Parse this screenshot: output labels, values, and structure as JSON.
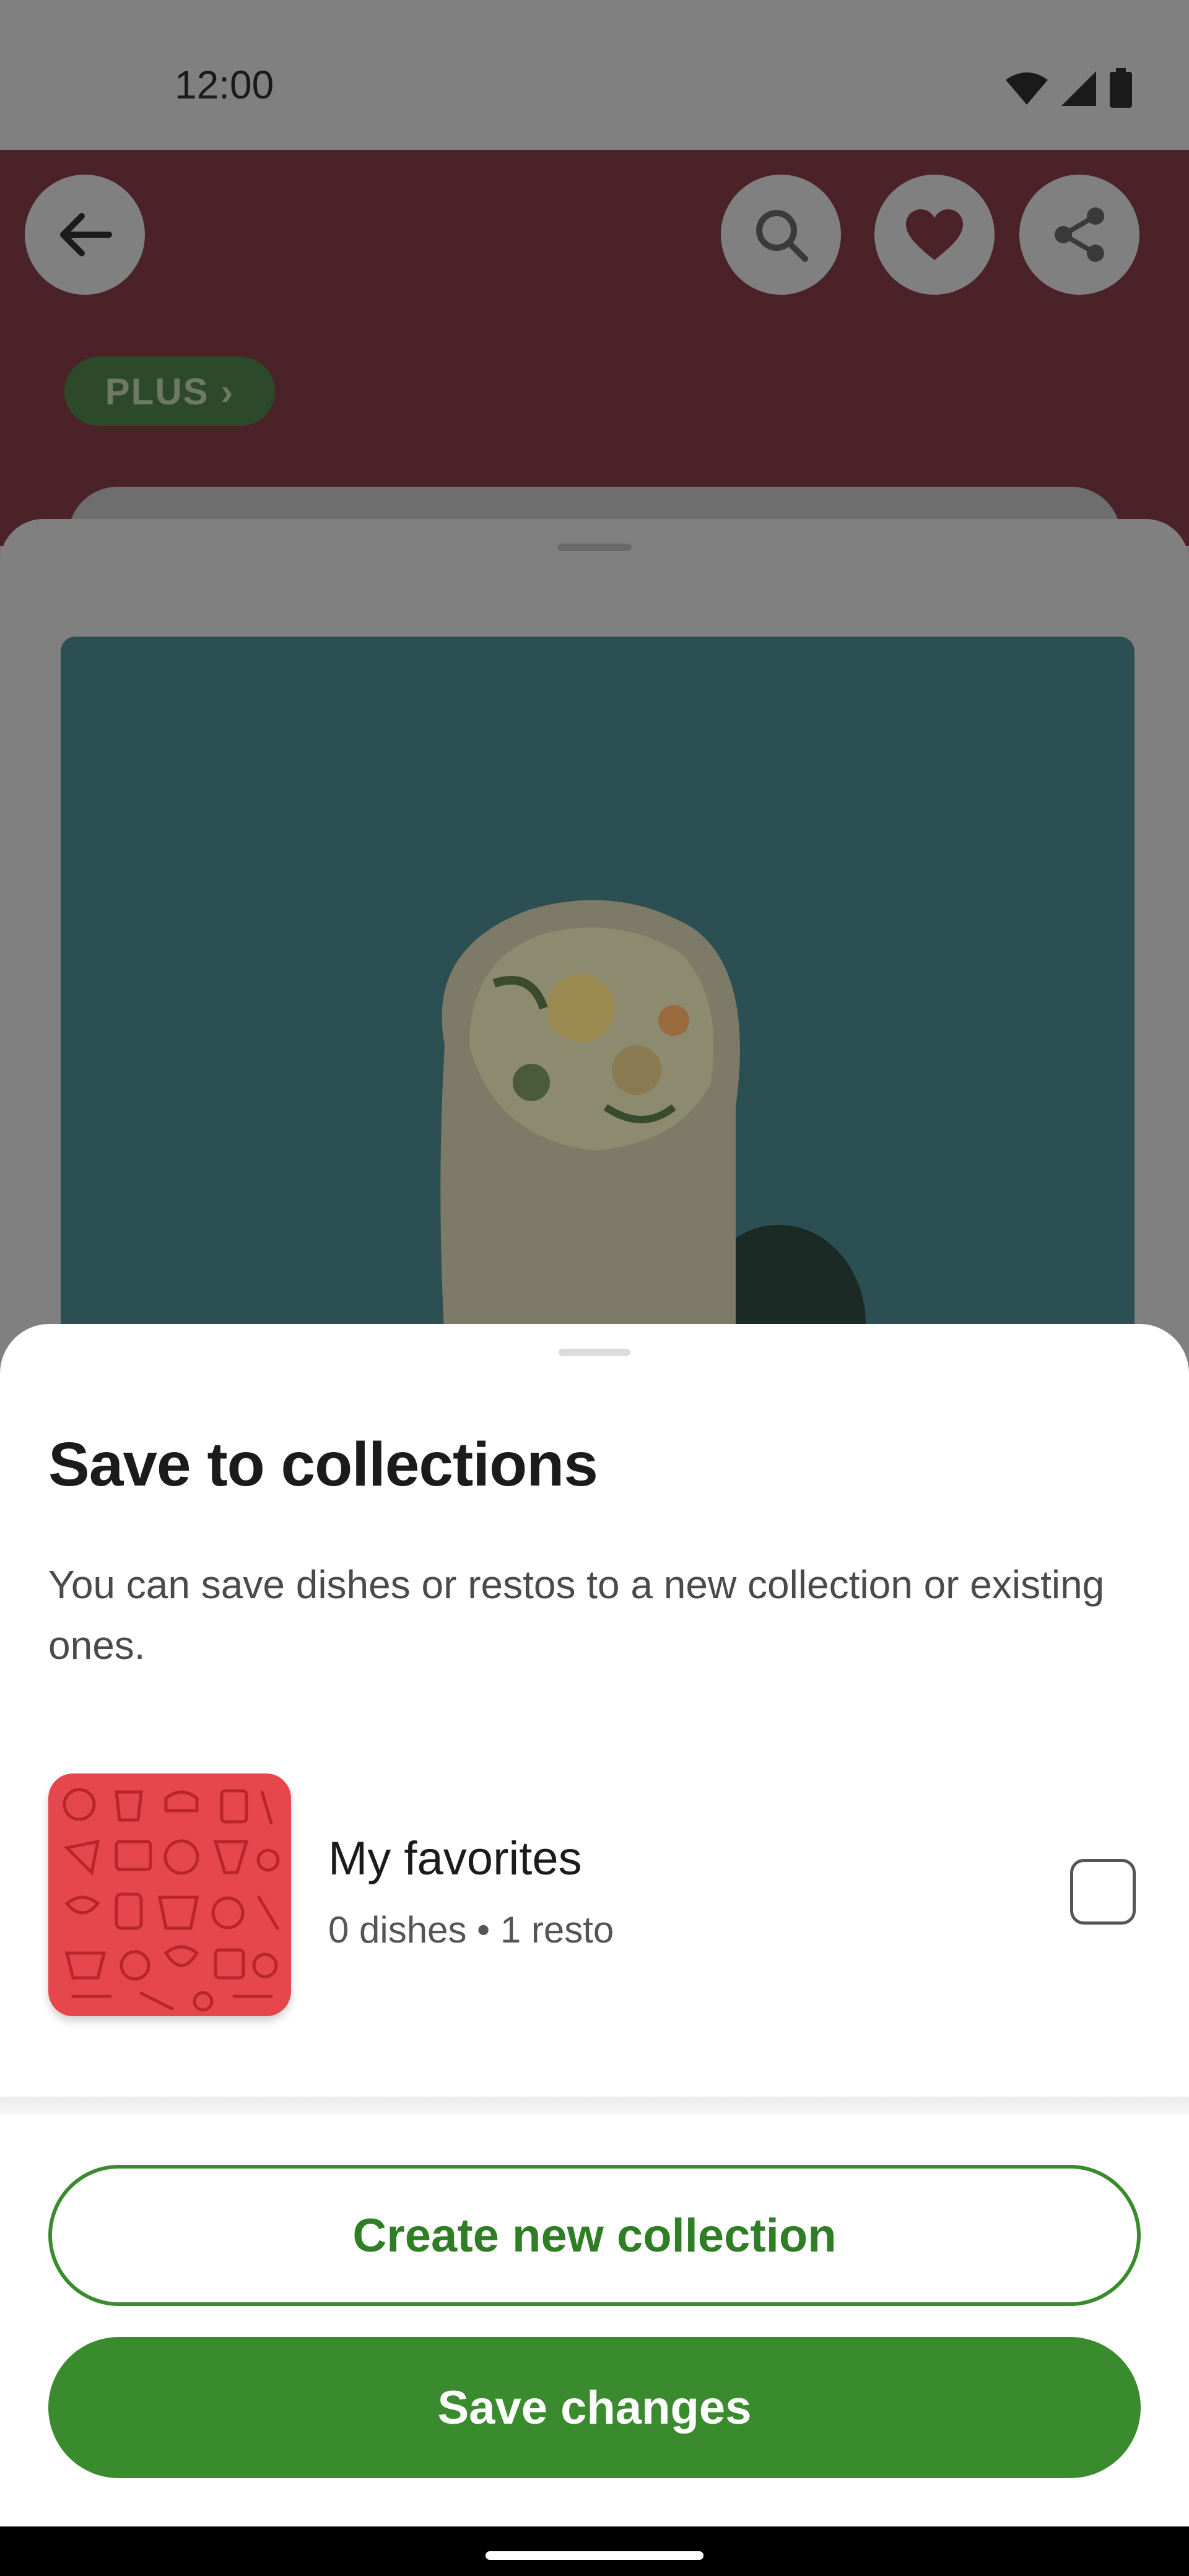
{
  "status_bar": {
    "time": "12:00",
    "icons": [
      "wifi-icon",
      "cellular-icon",
      "battery-icon"
    ]
  },
  "header": {
    "buttons": [
      "back-arrow-icon",
      "search-icon",
      "heart-icon",
      "share-icon"
    ],
    "plus_badge": "PLUS ›"
  },
  "sheet": {
    "title": "Save to collections",
    "description": "You can save dishes or restos to a new collection or existing ones.",
    "collections": [
      {
        "name": "My favorites",
        "meta": "0 dishes • 1 resto",
        "checked": false
      }
    ],
    "create_button": "Create new collection",
    "save_button": "Save changes"
  },
  "colors": {
    "accent_green": "#3a8a2e",
    "collection_red": "#e6474c",
    "header_red_dimmed": "#4a2227"
  }
}
